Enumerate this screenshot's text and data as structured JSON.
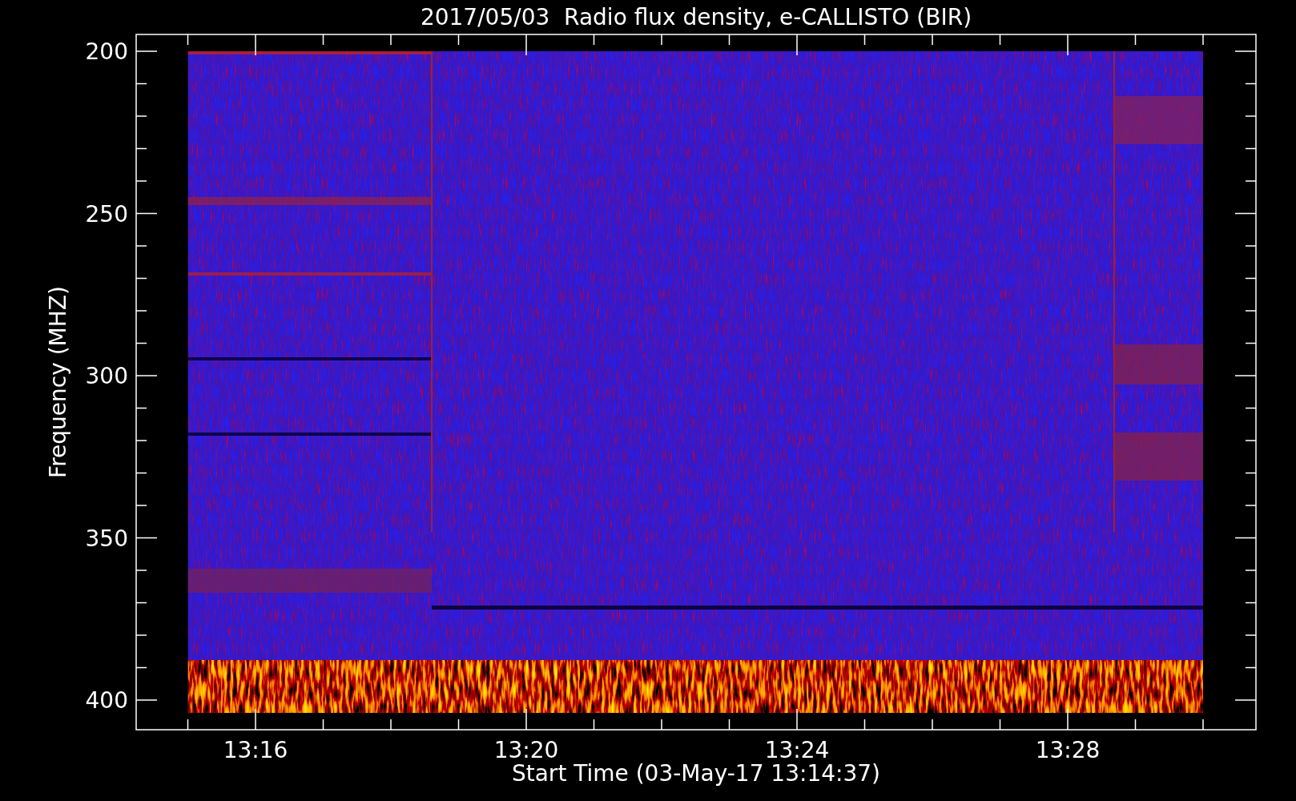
{
  "title": "2017/05/03  Radio flux density, e-CALLISTO (BIR)",
  "ylabel": "Frequency (MHZ)",
  "xlabel": "Start Time (03-May-17 13:14:37)",
  "yticks": [
    "200",
    "250",
    "300",
    "350",
    "400"
  ],
  "xticks": [
    "13:16",
    "13:20",
    "13:24",
    "13:28"
  ]
}
